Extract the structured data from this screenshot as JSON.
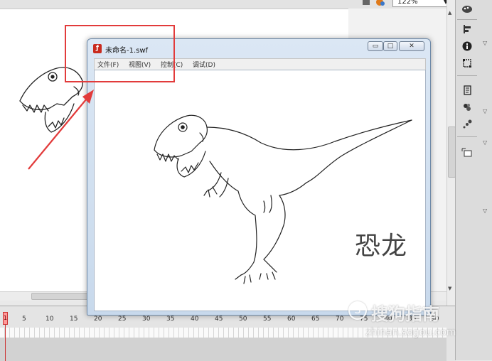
{
  "authoring": {
    "zoom_value": "122%"
  },
  "swf_window": {
    "title": "未命名-1.swf",
    "menu": [
      {
        "label": "文件(F)"
      },
      {
        "label": "视图(V)"
      },
      {
        "label": "控制(C)"
      },
      {
        "label": "调试(D)"
      }
    ],
    "content_label": "恐龙"
  },
  "timeline": {
    "current_frame": "1",
    "ticks": [
      "5",
      "10",
      "15",
      "20",
      "25",
      "30",
      "35",
      "40",
      "45",
      "50",
      "55",
      "60",
      "65",
      "70",
      "75",
      "80",
      "85",
      "90"
    ]
  },
  "watermark": {
    "brand": "搜狗指南",
    "site": "zhinan.sogou.com"
  },
  "colors": {
    "annotation_red": "#e23b3b",
    "player_icon_red": "#c92b1e"
  },
  "icons": {
    "right_panel": [
      "paintbrush-palette-icon",
      "align-icon",
      "info-icon",
      "transform-icon",
      "library-icon",
      "components-icon",
      "motion-presets-icon",
      "symbol-instance-icon"
    ]
  }
}
